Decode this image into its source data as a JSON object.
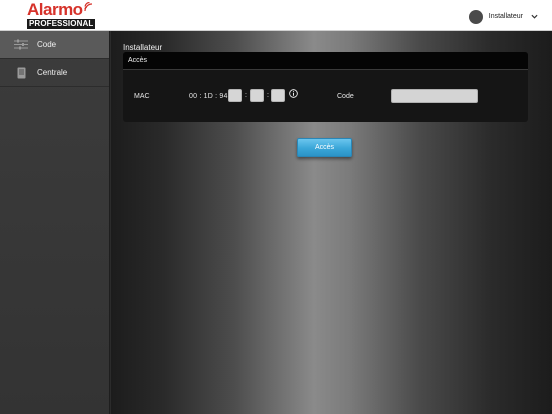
{
  "app": {
    "logo": {
      "wordmark": "Alarmo",
      "sub": "PROFESSIONAL",
      "brand_color": "#d6322a"
    }
  },
  "header": {
    "user_name": "Installateur",
    "user_menu_icon": "chevron-down-icon"
  },
  "sidebar": {
    "items": [
      {
        "label": "Code",
        "icon": "sliders-icon",
        "active": true
      },
      {
        "label": "Centrale",
        "icon": "device-icon",
        "active": false
      }
    ]
  },
  "main": {
    "section_title": "Installateur",
    "panel": {
      "title": "Accès",
      "mac": {
        "label": "MAC",
        "prefix": "00 : 1D : 94 :",
        "separator": ":",
        "fields": [
          "",
          "",
          ""
        ]
      },
      "code": {
        "label": "Code",
        "value": ""
      }
    },
    "submit_label": "Accès",
    "accent_color": "#3aa6d8"
  }
}
